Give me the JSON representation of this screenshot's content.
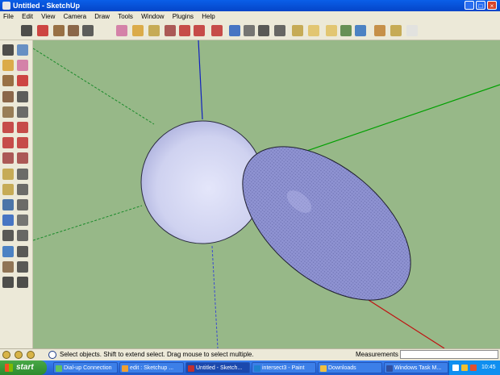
{
  "window": {
    "title": "Untitled - SketchUp",
    "minimize_glyph": "_",
    "maximize_glyph": "□",
    "close_glyph": "×"
  },
  "menu": [
    "File",
    "Edit",
    "View",
    "Camera",
    "Draw",
    "Tools",
    "Window",
    "Plugins",
    "Help"
  ],
  "toolbar": {
    "tools": [
      "select-icon",
      "pencil-icon",
      "rectangle-icon",
      "circle-icon",
      "arc-icon",
      "eraser-icon",
      "paint-bucket-icon",
      "make-component-icon",
      "push-pull-icon",
      "move-icon",
      "rotate-icon",
      "offset-icon",
      "orbit-icon",
      "pan-icon",
      "zoom-icon",
      "zoom-extents-icon",
      "previous-view-icon",
      "get-models-icon",
      "share-model-icon",
      "warehouse-icon",
      "component-icon",
      "extension-icon",
      "layer-icon",
      "shadow-icon"
    ]
  },
  "sidebar": {
    "tools": [
      "select-icon",
      "make-component-icon",
      "paint-bucket-icon",
      "eraser-icon",
      "rectangle-icon",
      "pencil-icon",
      "circle-icon",
      "arc-icon",
      "polygon-icon",
      "freehand-icon",
      "move-icon",
      "push-pull-icon",
      "rotate-icon",
      "follow-me-icon",
      "scale-icon",
      "offset-icon",
      "tape-measure-icon",
      "dimension-icon",
      "protractor-icon",
      "text-icon",
      "axes-icon",
      "3d-text-icon",
      "orbit-icon",
      "pan-icon",
      "zoom-icon",
      "zoom-window-icon",
      "zoom-extents-icon",
      "previous-icon",
      "walk-icon",
      "look-around-icon",
      "footprints-icon",
      "section-plane-icon"
    ]
  },
  "statusbar": {
    "status_text": "Select objects. Shift to extend select. Drag mouse to select multiple.",
    "measurements_label": "Measurements",
    "measurements_value": ""
  },
  "taskbar": {
    "start_label": "start",
    "tasks": [
      {
        "label": "Dial-up Connection",
        "active": false
      },
      {
        "label": "edit : Sketchup ...",
        "active": false
      },
      {
        "label": "Untitled - Sketch...",
        "active": true
      },
      {
        "label": "intersect3 - Paint",
        "active": false
      },
      {
        "label": "Downloads",
        "active": false
      },
      {
        "label": "Windows Task M...",
        "active": false
      }
    ],
    "clock": "10:45"
  },
  "colors": {
    "sky_ground": "#97b888",
    "axis_blue": "#1020c0",
    "axis_green": "#00a000",
    "axis_red": "#c01010",
    "sphere_fill": "#d8daf4",
    "ellipsoid_fill": "#8a8fd0",
    "titlebar": "#0a5fe8",
    "taskbar": "#245edb"
  }
}
